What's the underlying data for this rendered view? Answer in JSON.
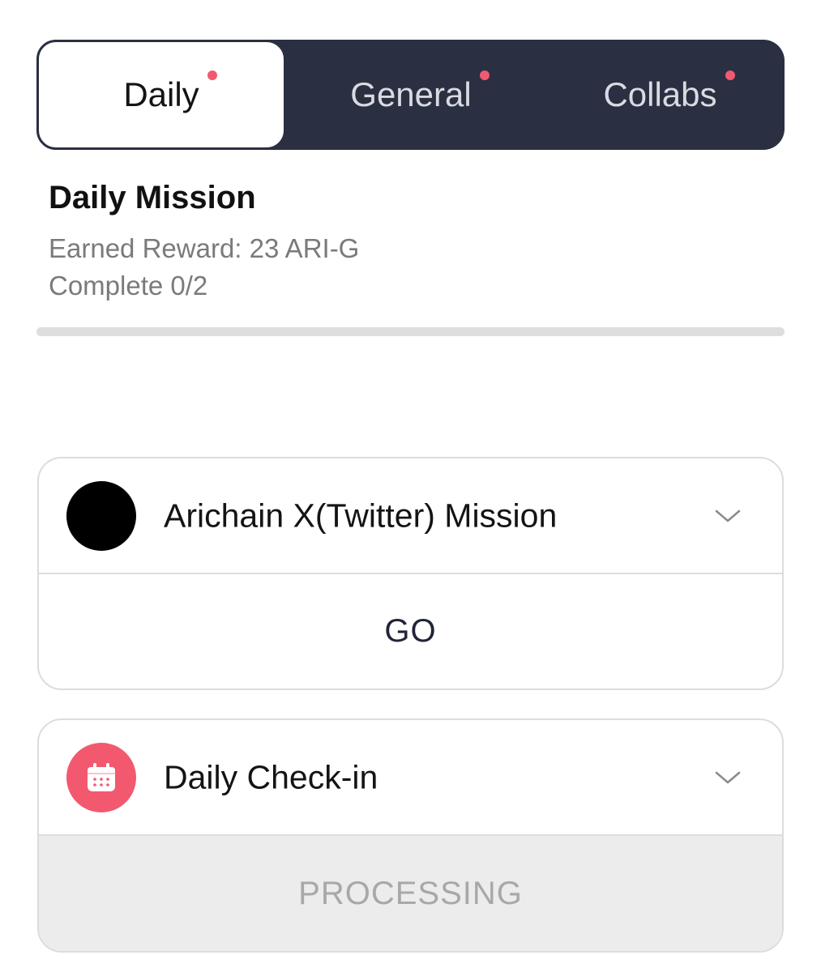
{
  "tabs": [
    {
      "label": "Daily",
      "active": true,
      "has_dot": true
    },
    {
      "label": "General",
      "active": false,
      "has_dot": true
    },
    {
      "label": "Collabs",
      "active": false,
      "has_dot": true
    }
  ],
  "header": {
    "title": "Daily Mission",
    "earned_reward": "Earned Reward: 23 ARI-G",
    "complete": "Complete 0/2",
    "progress_fraction": 0
  },
  "missions": [
    {
      "title": "Arichain X(Twitter) Mission",
      "icon": "black-circle-icon",
      "action_label": "GO",
      "action_state": "enabled"
    },
    {
      "title": "Daily Check-in",
      "icon": "calendar-icon",
      "action_label": "PROCESSING",
      "action_state": "disabled"
    }
  ],
  "colors": {
    "tabbar_bg": "#2a2f42",
    "accent": "#f2596f",
    "muted_text": "#7a7a7a",
    "border": "#dcdcdc"
  }
}
